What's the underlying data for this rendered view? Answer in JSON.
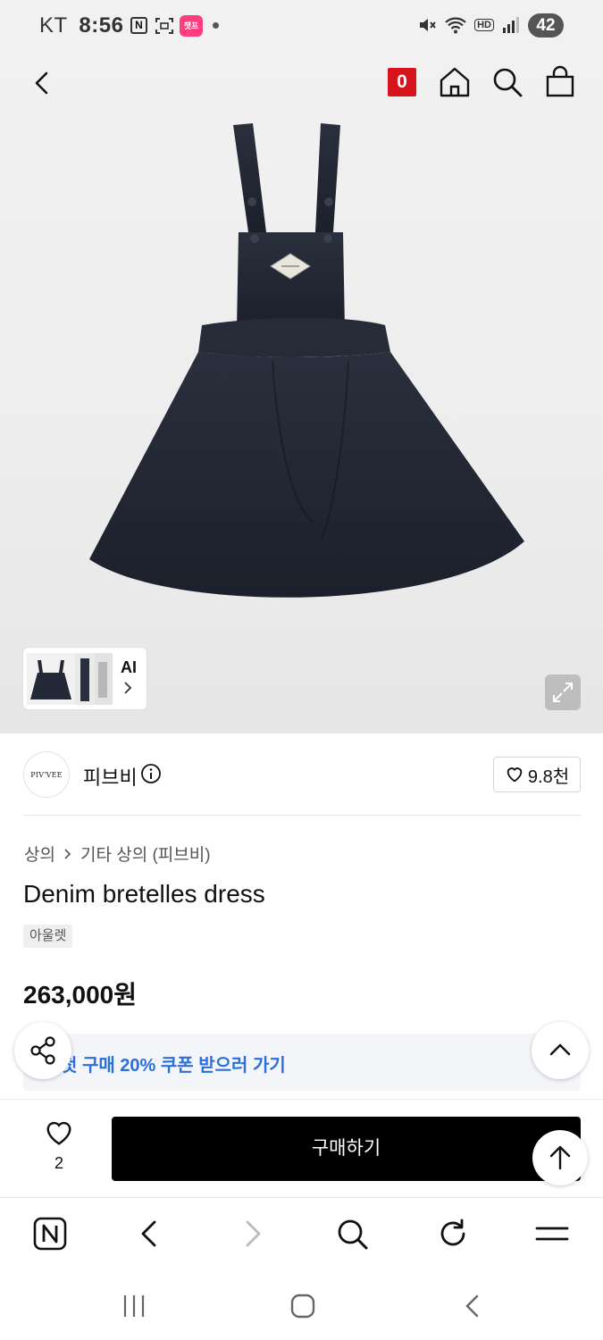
{
  "status_bar": {
    "carrier": "KT",
    "time": "8:56",
    "n_badge": "N",
    "app_badge": "챗프",
    "hd": "HD",
    "battery": "42"
  },
  "header": {
    "cart_count": "0"
  },
  "gallery": {
    "ai_label": "AI"
  },
  "brand": {
    "logo_text": "PIV'VEE",
    "name": "피브비",
    "likes": "9.8천"
  },
  "product": {
    "breadcrumb": [
      "상의",
      "기타 상의 (피브비)"
    ],
    "title": "Denim bretelles dress",
    "tag": "아울렛",
    "price": "263,000원",
    "coupon": "첫 구매 20% 쿠폰 받으러 가기"
  },
  "purchase": {
    "wish_count": "2",
    "buy_label": "구매하기"
  },
  "colors": {
    "badge_red": "#d5141b",
    "coupon_blue": "#2a6fdc",
    "buy_button": "#000000"
  }
}
